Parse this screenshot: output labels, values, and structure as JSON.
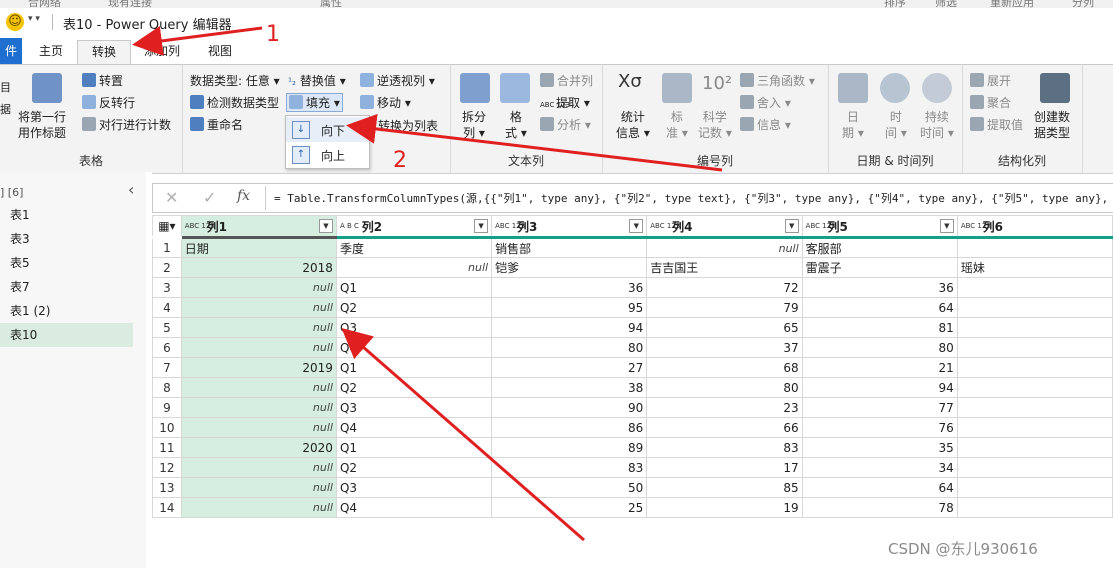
{
  "window": {
    "title": "表10 - Power Query 编辑器",
    "top_strip": [
      "合网络",
      "现有连接",
      "属性",
      "排序",
      "筛选",
      "重新应用",
      "分列"
    ]
  },
  "tabs": [
    {
      "label": "件",
      "state": "file"
    },
    {
      "label": "主页",
      "state": "normal"
    },
    {
      "label": "转换",
      "state": "active"
    },
    {
      "label": "添加列",
      "state": "normal"
    },
    {
      "label": "视图",
      "state": "normal"
    }
  ],
  "ribbon": {
    "table_group": {
      "label": "表格",
      "first_row_btn": "将第一行\n用作标题",
      "transpose": "转置",
      "reverse_rows": "反转行",
      "count_rows": "对行进行计数",
      "left_partial": "目\n据"
    },
    "anycol_group": {
      "data_type": "数据类型: 任意",
      "detect_type": "检测数据类型",
      "rename": "重命名",
      "replace_values": "替换值",
      "fill": "填充",
      "unpivot": "逆透视列",
      "move": "移动",
      "to_list": "转换为列表"
    },
    "fill_menu": {
      "down": "向下",
      "up": "向上"
    },
    "text_group": {
      "label": "文本列",
      "split": "拆分\n列",
      "format": "格\n式",
      "merge": "合并列",
      "extract": "提取",
      "parse": "分析"
    },
    "number_group": {
      "label": "编号列",
      "stats": "统计\n信息",
      "standard": "标\n准",
      "scientific": "科学\n记数",
      "trig": "三角函数",
      "rounding": "舍入",
      "info": "信息"
    },
    "datetime_group": {
      "label": "日期 & 时间列",
      "date": "日\n期",
      "time": "时\n间",
      "duration": "持续\n时间"
    },
    "struct_group": {
      "label": "结构化列",
      "expand": "展开",
      "aggregate": "聚合",
      "extract_values": "提取值",
      "create_type": "创建数\n据类型"
    }
  },
  "nav": {
    "header": "] [6]",
    "queries": [
      "表1",
      "表3",
      "表5",
      "表7",
      "表1 (2)",
      "表10"
    ],
    "selected": "表10"
  },
  "formula_bar": {
    "cancel": "✕",
    "commit": "✓",
    "fx": "fx",
    "formula": "= Table.TransformColumnTypes(源,{{\"列1\", type any}, {\"列2\", type text}, {\"列3\", type any}, {\"列4\", type any}, {\"列5\", type any},"
  },
  "grid": {
    "columns": [
      {
        "name": "列1",
        "type": "ABC\n123"
      },
      {
        "name": "列2",
        "type": "A B C"
      },
      {
        "name": "列3",
        "type": "ABC\n123"
      },
      {
        "name": "列4",
        "type": "ABC\n123"
      },
      {
        "name": "列5",
        "type": "ABC\n123"
      },
      {
        "name": "列6",
        "type": "ABC\n123"
      }
    ],
    "rows": [
      [
        "1",
        "日期",
        "季度",
        "销售部",
        "null",
        "客服部",
        ""
      ],
      [
        "2",
        "2018",
        "null",
        "铠爹",
        "吉吉国王",
        "雷震子",
        "瑶妹"
      ],
      [
        "3",
        "null",
        "Q1",
        "36",
        "72",
        "36",
        ""
      ],
      [
        "4",
        "null",
        "Q2",
        "95",
        "79",
        "64",
        ""
      ],
      [
        "5",
        "null",
        "Q3",
        "94",
        "65",
        "81",
        ""
      ],
      [
        "6",
        "null",
        "Q4",
        "80",
        "37",
        "80",
        ""
      ],
      [
        "7",
        "2019",
        "Q1",
        "27",
        "68",
        "21",
        ""
      ],
      [
        "8",
        "null",
        "Q2",
        "38",
        "80",
        "94",
        ""
      ],
      [
        "9",
        "null",
        "Q3",
        "90",
        "23",
        "77",
        ""
      ],
      [
        "10",
        "null",
        "Q4",
        "86",
        "66",
        "76",
        ""
      ],
      [
        "11",
        "2020",
        "Q1",
        "89",
        "83",
        "35",
        ""
      ],
      [
        "12",
        "null",
        "Q2",
        "83",
        "17",
        "34",
        ""
      ],
      [
        "13",
        "null",
        "Q3",
        "50",
        "85",
        "64",
        ""
      ],
      [
        "14",
        "null",
        "Q4",
        "25",
        "19",
        "78",
        ""
      ]
    ]
  },
  "annotations": {
    "step1": "1",
    "step2": "2"
  },
  "watermark": "CSDN @东儿930616",
  "colors": {
    "accent_blue": "#1f6fd1",
    "selected_column": "#d6eee0",
    "header_line": "#12a08c",
    "arrow_red": "#e02020"
  }
}
